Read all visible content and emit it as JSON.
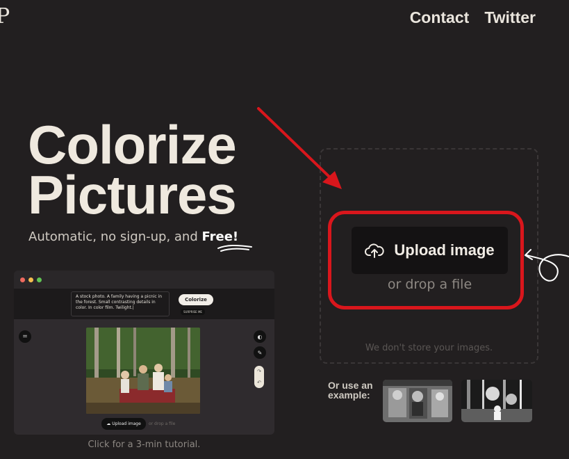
{
  "header": {
    "logo_letter": "P",
    "nav": [
      {
        "label": "Contact"
      },
      {
        "label": "Twitter"
      }
    ]
  },
  "hero": {
    "title_line1": "Colorize",
    "title_line2": "Pictures",
    "subtitle_prefix": "Automatic, no sign-up, and",
    "subtitle_free": "Free!"
  },
  "preview": {
    "prompt_text": "A stock photo. A family having a picnic in the forest. Small contrasting details in color. In color film. Twilight.|",
    "colorize_label": "Colorize",
    "surprise_label": "SURPRISE ME",
    "upload_label": "Upload image",
    "drop_label": "or drop a file",
    "caption": "Click for a 3-min tutorial."
  },
  "uploader": {
    "button_label": "Upload image",
    "drop_text": "or drop a file",
    "privacy_note": "We don't store your images."
  },
  "examples": {
    "label_line1": "Or use an",
    "label_line2": "example:"
  },
  "colors": {
    "background": "#221f20",
    "text": "#eae5dd",
    "annotation_red": "#d9161c"
  }
}
